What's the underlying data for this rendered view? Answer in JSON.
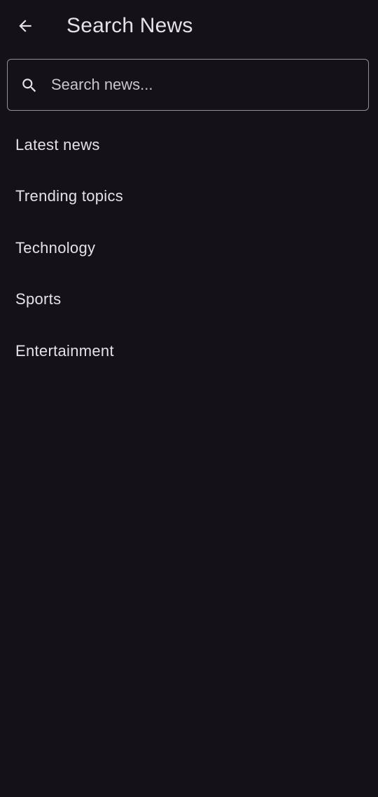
{
  "header": {
    "title": "Search News",
    "back_icon": "arrow-back-icon"
  },
  "search": {
    "placeholder": "Search news...",
    "value": "",
    "icon": "search-icon"
  },
  "suggestions": [
    {
      "label": "Latest news"
    },
    {
      "label": "Trending topics"
    },
    {
      "label": "Technology"
    },
    {
      "label": "Sports"
    },
    {
      "label": "Entertainment"
    }
  ],
  "colors": {
    "background": "#141218",
    "text": "#e6e0e9",
    "outline": "#938f99",
    "placeholder": "#cac4d0"
  }
}
